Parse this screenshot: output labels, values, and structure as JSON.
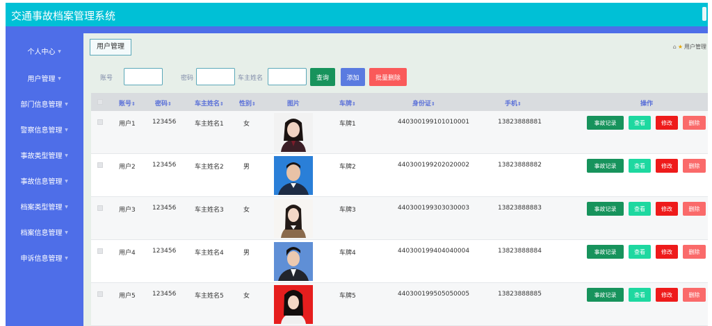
{
  "app": {
    "title": "交通事故档案管理系统"
  },
  "sidebar": {
    "items": [
      {
        "label": "个人中心"
      },
      {
        "label": "用户管理"
      },
      {
        "label": "部门信息管理"
      },
      {
        "label": "警察信息管理"
      },
      {
        "label": "事故类型管理"
      },
      {
        "label": "事故信息管理"
      },
      {
        "label": "档案类型管理"
      },
      {
        "label": "档案信息管理"
      },
      {
        "label": "申诉信息管理"
      }
    ]
  },
  "breadcrumb": {
    "tab": "用户管理",
    "path": "用户管理"
  },
  "search": {
    "account_label": "账号",
    "password_label": "密码",
    "owner_label": "车主姓名",
    "query_button": "查询",
    "add_button": "添加",
    "batch_delete_button": "批量删除"
  },
  "table": {
    "headers": {
      "account": "账号",
      "password": "密码",
      "owner": "车主姓名",
      "gender": "性别",
      "photo": "图片",
      "plate": "车牌",
      "id_card": "身份证",
      "phone": "手机",
      "actions": "操作"
    },
    "sort_glyph": "⇕",
    "rows": [
      {
        "account": "用户1",
        "password": "123456",
        "owner": "车主姓名1",
        "gender": "女",
        "plate": "车牌1",
        "id_card": "440300199101010001",
        "phone": "13823888881"
      },
      {
        "account": "用户2",
        "password": "123456",
        "owner": "车主姓名2",
        "gender": "男",
        "plate": "车牌2",
        "id_card": "440300199202020002",
        "phone": "13823888882"
      },
      {
        "account": "用户3",
        "password": "123456",
        "owner": "车主姓名3",
        "gender": "女",
        "plate": "车牌3",
        "id_card": "440300199303030003",
        "phone": "13823888883"
      },
      {
        "account": "用户4",
        "password": "123456",
        "owner": "车主姓名4",
        "gender": "男",
        "plate": "车牌4",
        "id_card": "440300199404040004",
        "phone": "13823888884"
      },
      {
        "account": "用户5",
        "password": "123456",
        "owner": "车主姓名5",
        "gender": "女",
        "plate": "车牌5",
        "id_card": "440300199505050005",
        "phone": "13823888885"
      }
    ],
    "row_actions": {
      "record": "事故记录",
      "view": "查看",
      "edit": "修改",
      "delete": "删除"
    }
  },
  "colors": {
    "header_bg": "#00c0d6",
    "sidebar_bg": "#4e6ee8",
    "query_btn": "#17935c",
    "add_btn": "#5a7be0",
    "batch_delete_btn": "#fa5a5a"
  }
}
